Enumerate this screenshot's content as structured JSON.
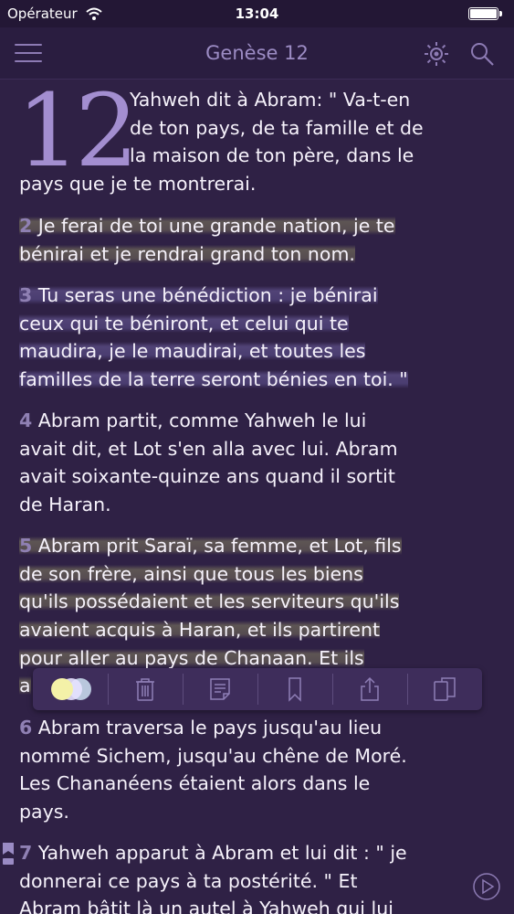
{
  "status_bar": {
    "carrier": "Opérateur",
    "time": "13:04",
    "icons": [
      "wifi-icon",
      "battery-icon"
    ]
  },
  "nav": {
    "title": "Genèse 12",
    "icons": [
      "menu-icon",
      "brightness-icon",
      "search-icon"
    ]
  },
  "chapter": {
    "number": "12",
    "verses": [
      {
        "num": "",
        "line1": "Yahweh dit à Abram: \" Va-t-en",
        "line2": "de ton pays, de ta famille et de",
        "line3": "la maison de ton père, dans le",
        "rest": "pays que je te montrerai."
      },
      {
        "num": "2",
        "lines": [
          "Je ferai de toi une grande nation, je te",
          "bénirai et je rendrai grand ton nom."
        ]
      },
      {
        "num": "3",
        "lines": [
          "Tu seras une bénédiction : je bénirai",
          "ceux qui te béniront, et celui qui te",
          "maudira, je le maudirai, et toutes les",
          "familles de la terre seront bénies en toi. \""
        ]
      },
      {
        "num": "4",
        "lines": [
          "Abram partit, comme Yahweh le lui",
          "avait dit, et Lot s'en alla avec lui. Abram",
          "avait soixante-quinze ans quand il sortit",
          "de Haran."
        ]
      },
      {
        "num": "5",
        "lines": [
          "Abram prit Saraï, sa femme, et Lot, fils",
          "de son frère, ainsi que tous les biens",
          "qu'ils possédaient et les serviteurs qu'ils",
          "avaient acquis à Haran, et ils partirent",
          "pour aller au pays de Chanaan. Et ils",
          "a"
        ]
      },
      {
        "num": "6",
        "lines": [
          "Abram traversa le pays jusqu'au lieu",
          "nommé Sichem, jusqu'au chêne de Moré.",
          "Les Chananéens étaient alors dans le",
          "pays."
        ]
      },
      {
        "num": "7",
        "lines": [
          "Yahweh apparut à Abram et lui dit : \" je",
          "donnerai ce pays à ta postérité. \" Et",
          "Abram bâtit là un autel à Yahweh qui lui"
        ]
      }
    ]
  },
  "toolbar": {
    "items": [
      "highlight-colors-icon",
      "trash-icon",
      "note-icon",
      "bookmark-icon",
      "share-icon",
      "copy-icon"
    ],
    "highlight_colors": [
      "#f4f1a8",
      "#e7e2ff",
      "#cfe3f5"
    ]
  },
  "colors": {
    "background": "#2f2145",
    "accent": "#a38ed0",
    "verse_number": "#8f80b3",
    "toolbar": "#3e2d5b"
  }
}
